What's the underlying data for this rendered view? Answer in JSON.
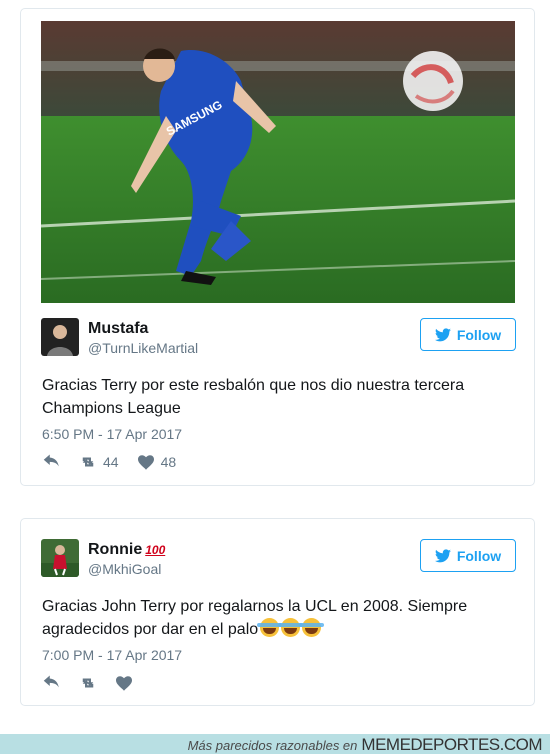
{
  "tweets": [
    {
      "name": "Mustafa",
      "handle": "@TurnLikeMartial",
      "follow_label": "Follow",
      "text_line1": "Gracias Terry por este resbalón que nos dio nuestra tercera",
      "text_line2": "Champions League",
      "time": "6:50 PM - 17 Apr 2017",
      "retweets": "44",
      "likes": "48",
      "photo_caption": "SAMSUNG"
    },
    {
      "name": "Ronnie",
      "handle": "@MkhiGoal",
      "follow_label": "Follow",
      "text_line1": "Gracias John Terry por regalarnos la UCL en 2008. Siempre",
      "text_line2": "agradecidos por dar en el palo",
      "time": "7:00 PM - 17 Apr 2017",
      "badge": "100"
    }
  ],
  "footer": {
    "tagline": "Más parecidos razonables en",
    "brand": "MEMEDEPORTES.COM"
  },
  "colors": {
    "twitter_blue": "#1da1f2",
    "meta_gray": "#657786",
    "footer_bg": "#b8dfe3"
  }
}
